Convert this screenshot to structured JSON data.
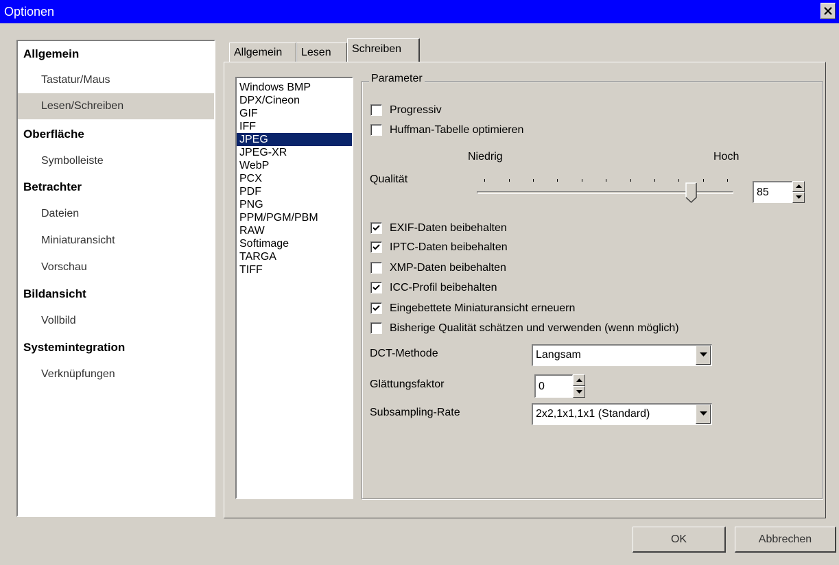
{
  "window": {
    "title": "Optionen"
  },
  "sidebar": {
    "items": [
      {
        "label": "Allgemein",
        "level": "category"
      },
      {
        "label": "Tastatur/Maus",
        "level": "sub"
      },
      {
        "label": "Lesen/Schreiben",
        "level": "sub",
        "selected": true
      },
      {
        "label": "Oberfläche",
        "level": "category"
      },
      {
        "label": "Symbolleiste",
        "level": "sub"
      },
      {
        "label": "Betrachter",
        "level": "category"
      },
      {
        "label": "Dateien",
        "level": "sub"
      },
      {
        "label": "Miniaturansicht",
        "level": "sub"
      },
      {
        "label": "Vorschau",
        "level": "sub"
      },
      {
        "label": "Bildansicht",
        "level": "category"
      },
      {
        "label": "Vollbild",
        "level": "sub"
      },
      {
        "label": "Systemintegration",
        "level": "category"
      },
      {
        "label": "Verknüpfungen",
        "level": "sub"
      }
    ]
  },
  "tabs": [
    {
      "label": "Allgemein"
    },
    {
      "label": "Lesen"
    },
    {
      "label": "Schreiben",
      "active": true
    }
  ],
  "formats": {
    "selected": "JPEG",
    "items": [
      "Windows BMP",
      "DPX/Cineon",
      "GIF",
      "IFF",
      "JPEG",
      "JPEG-XR",
      "WebP",
      "PCX",
      "PDF",
      "PNG",
      "PPM/PGM/PBM",
      "RAW",
      "Softimage",
      "TARGA",
      "TIFF"
    ]
  },
  "parameters": {
    "group_label": "Parameter",
    "progressive": {
      "label": "Progressiv",
      "checked": false
    },
    "huffman": {
      "label": "Huffman-Tabelle optimieren",
      "checked": false
    },
    "quality": {
      "label": "Qualität",
      "low_label": "Niedrig",
      "high_label": "Hoch",
      "value": "85",
      "min": 0,
      "max": 100
    },
    "options": [
      {
        "label": "EXIF-Daten beibehalten",
        "checked": true
      },
      {
        "label": "IPTC-Daten beibehalten",
        "checked": true
      },
      {
        "label": "XMP-Daten beibehalten",
        "checked": false
      },
      {
        "label": "ICC-Profil beibehalten",
        "checked": true
      },
      {
        "label": "Eingebettete Miniaturansicht erneuern",
        "checked": true
      },
      {
        "label": "Bisherige Qualität schätzen und verwenden (wenn möglich)",
        "checked": false
      }
    ],
    "dct": {
      "label": "DCT-Methode",
      "value": "Langsam"
    },
    "smoothing": {
      "label": "Glättungsfaktor",
      "value": "0"
    },
    "subsampling": {
      "label": "Subsampling-Rate",
      "value": "2x2,1x1,1x1 (Standard)"
    }
  },
  "buttons": {
    "ok": "OK",
    "cancel": "Abbrechen"
  },
  "colors": {
    "titlebar": "#0000ff",
    "selection": "#0a246a",
    "face": "#d4d0c8"
  }
}
